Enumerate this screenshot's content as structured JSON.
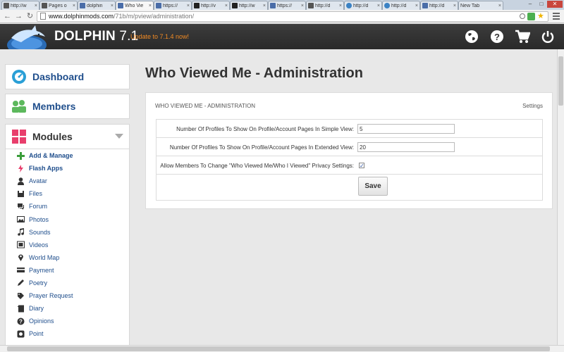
{
  "browser": {
    "tabs": [
      {
        "label": "http://w",
        "fav": "g"
      },
      {
        "label": "Pages o",
        "fav": "g"
      },
      {
        "label": "dolphin",
        "fav": ""
      },
      {
        "label": "Who Vie",
        "fav": "",
        "active": true
      },
      {
        "label": "https://",
        "fav": ""
      },
      {
        "label": "http://v",
        "fav": "e"
      },
      {
        "label": "http://w",
        "fav": "e"
      },
      {
        "label": "https://",
        "fav": ""
      },
      {
        "label": "http://d",
        "fav": "g"
      },
      {
        "label": "http://d",
        "fav": "c"
      },
      {
        "label": "http://d",
        "fav": "c"
      },
      {
        "label": "http://d",
        "fav": ""
      },
      {
        "label": "New Tab",
        "fav": "none"
      }
    ],
    "url_host": "www.dolphinmods.com",
    "url_path": "/71b/m/pview/administration/"
  },
  "header": {
    "brand": "DOLPHIN",
    "version": "7.1",
    "update_notice": "Update to 7.1.4 now!",
    "icons": [
      "globe-icon",
      "help-icon",
      "cart-icon",
      "power-icon"
    ]
  },
  "sidebar": {
    "dashboard": "Dashboard",
    "members": "Members",
    "modules": "Modules",
    "items": [
      {
        "label": "Add & Manage",
        "icon": "plus-icon",
        "bold": true
      },
      {
        "label": "Flash Apps",
        "icon": "flash-icon",
        "bold": true
      },
      {
        "label": "Avatar",
        "icon": "avatar-icon"
      },
      {
        "label": "Files",
        "icon": "files-icon"
      },
      {
        "label": "Forum",
        "icon": "forum-icon"
      },
      {
        "label": "Photos",
        "icon": "photos-icon"
      },
      {
        "label": "Sounds",
        "icon": "sounds-icon"
      },
      {
        "label": "Videos",
        "icon": "videos-icon"
      },
      {
        "label": "World Map",
        "icon": "map-pin-icon"
      },
      {
        "label": "Payment",
        "icon": "payment-icon"
      },
      {
        "label": "Poetry",
        "icon": "pencil-icon"
      },
      {
        "label": "Prayer Request",
        "icon": "tag-icon"
      },
      {
        "label": "Diary",
        "icon": "diary-icon"
      },
      {
        "label": "Opinions",
        "icon": "opinions-icon"
      },
      {
        "label": "Point",
        "icon": "point-icon"
      }
    ]
  },
  "main": {
    "title": "Who Viewed Me - Administration",
    "panel_title": "WHO VIEWED ME - ADMINISTRATION",
    "settings_link": "Settings",
    "simple_label": "Number Of Profiles To Show On Profile/Account Pages In Simple View:",
    "simple_value": "5",
    "extended_label": "Number Of Profiles To Show On Profile/Account Pages In Extended View:",
    "extended_value": "20",
    "privacy_label": "Allow Members To Change \"Who Viewed Me/Who I Viewed\" Privacy Settings:",
    "privacy_checked": true,
    "save": "Save"
  },
  "colors": {
    "accent_blue": "#1f4e8c",
    "update_orange": "#f08a24",
    "header_bg": "#333333",
    "dashboard_icon": "#2a9fd6",
    "members_icon": "#5cb85c",
    "modules_icon": "#e83e6c"
  }
}
